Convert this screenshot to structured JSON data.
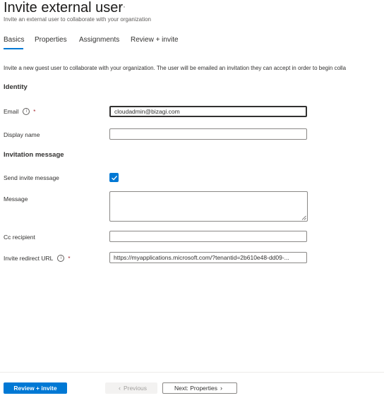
{
  "header": {
    "title": "Invite external user",
    "more_label": "···",
    "subtitle": "Invite an external user to collaborate with your organization"
  },
  "tabs": [
    {
      "label": "Basics",
      "active": true
    },
    {
      "label": "Properties",
      "active": false
    },
    {
      "label": "Assignments",
      "active": false
    },
    {
      "label": "Review + invite",
      "active": false
    }
  ],
  "intro_text": "Invite a new guest user to collaborate with your organization. The user will be emailed an invitation they can accept in order to begin colla",
  "identity": {
    "heading": "Identity",
    "email": {
      "label": "Email",
      "required_mark": "*",
      "value": "cloudadmin@bizagi.com"
    },
    "display_name": {
      "label": "Display name",
      "value": ""
    }
  },
  "invitation": {
    "heading": "Invitation message",
    "send_invite": {
      "label": "Send invite message",
      "checked": true
    },
    "message": {
      "label": "Message",
      "value": ""
    },
    "cc_recipient": {
      "label": "Cc recipient",
      "value": ""
    },
    "redirect_url": {
      "label": "Invite redirect URL",
      "required_mark": "*",
      "value": "https://myapplications.microsoft.com/?tenantid=2b610e48-dd09-..."
    }
  },
  "footer": {
    "review_invite_label": "Review + invite",
    "previous_label": "Previous",
    "next_label": "Next: Properties"
  },
  "colors": {
    "accent": "#0078d4",
    "required": "#a4262c",
    "text": "#323130"
  }
}
